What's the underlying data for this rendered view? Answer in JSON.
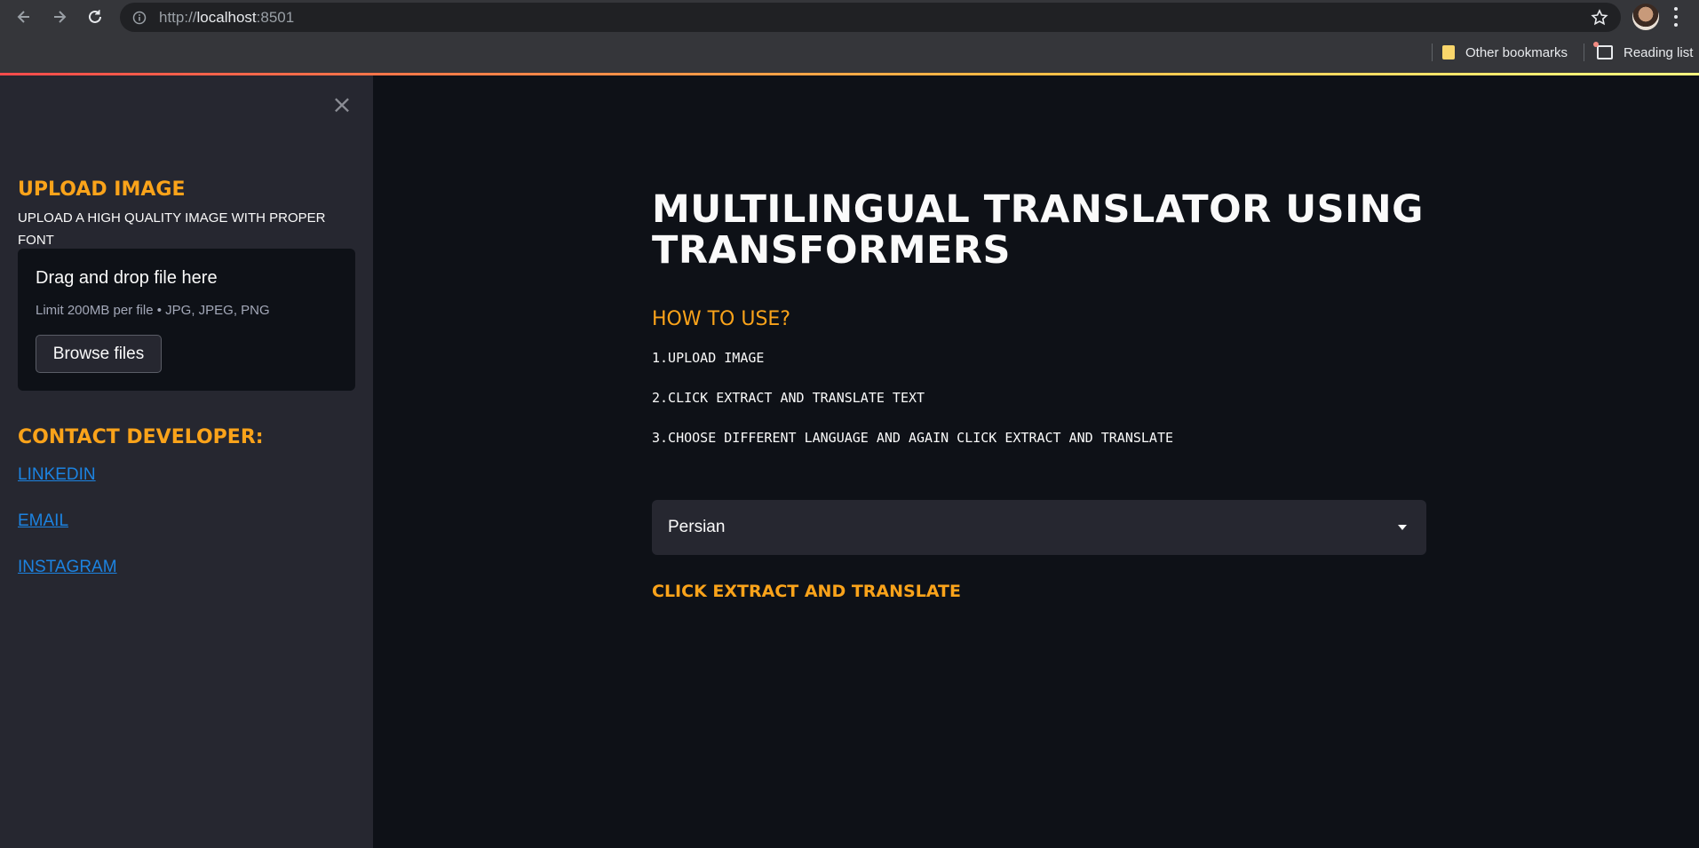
{
  "browser": {
    "url_scheme": "http://",
    "url_host": "localhost",
    "url_port": ":8501",
    "bookmarks": {
      "other": "Other bookmarks",
      "reading": "Reading list"
    }
  },
  "sidebar": {
    "upload_heading": "UPLOAD IMAGE",
    "upload_sub": "UPLOAD A HIGH QUALITY IMAGE WITH PROPER FONT",
    "uploader": {
      "drag_text": "Drag and drop file here",
      "limit_text": "Limit 200MB per file • JPG, JPEG, PNG",
      "browse_label": "Browse files"
    },
    "contact_heading": "CONTACT DEVELOPER:",
    "links": [
      "LINKEDIN",
      "EMAIL",
      "INSTAGRAM"
    ]
  },
  "main": {
    "title": "MULTILINGUAL TRANSLATOR USING TRANSFORMERS",
    "howto_heading": "HOW TO USE?",
    "steps": [
      "1.UPLOAD IMAGE",
      "2.CLICK EXTRACT AND TRANSLATE TEXT",
      "3.CHOOSE DIFFERENT LANGUAGE AND AGAIN CLICK EXTRACT AND TRANSLATE"
    ],
    "language_select": "Persian",
    "cta": "CLICK EXTRACT AND TRANSLATE"
  },
  "colors": {
    "accent": "#faa31a",
    "link": "#1c83e1",
    "sidebar_bg": "#262730",
    "main_bg": "#0e1117"
  }
}
